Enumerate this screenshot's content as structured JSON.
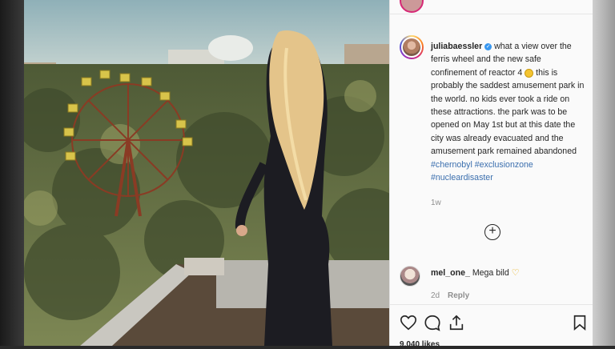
{
  "post": {
    "username": "juliabaessler",
    "caption_part1": " what a view over the ferris wheel and the new safe confinement of reactor 4 ",
    "caption_part2": " this is probably the saddest amusement park in the world. no kids ever took a ride on these attractions. the park was to be opened on May 1st but at this date the city was already evacuated and the amusement park remained abandoned ",
    "hashtags": [
      "#chernobyl",
      "#exclusionzone",
      "#nucleardisaster"
    ],
    "time": "1w",
    "likes": "9,040 likes"
  },
  "comment": {
    "username": "mel_one_",
    "text": " Mega bild ",
    "time": "2d",
    "reply_label": "Reply"
  },
  "icons": {
    "verified": "verified-badge-icon",
    "emoji": "smiling-face-emoji",
    "heart_emoji": "yellow-heart-emoji",
    "next": "chevron-right-icon",
    "load_more": "plus-circle-icon",
    "like": "heart-icon",
    "comment": "comment-bubble-icon",
    "share": "share-icon",
    "save": "bookmark-icon"
  },
  "colors": {
    "hashtag": "#3b6fae",
    "verified": "#3897f0",
    "muted": "#8e8e8e"
  }
}
